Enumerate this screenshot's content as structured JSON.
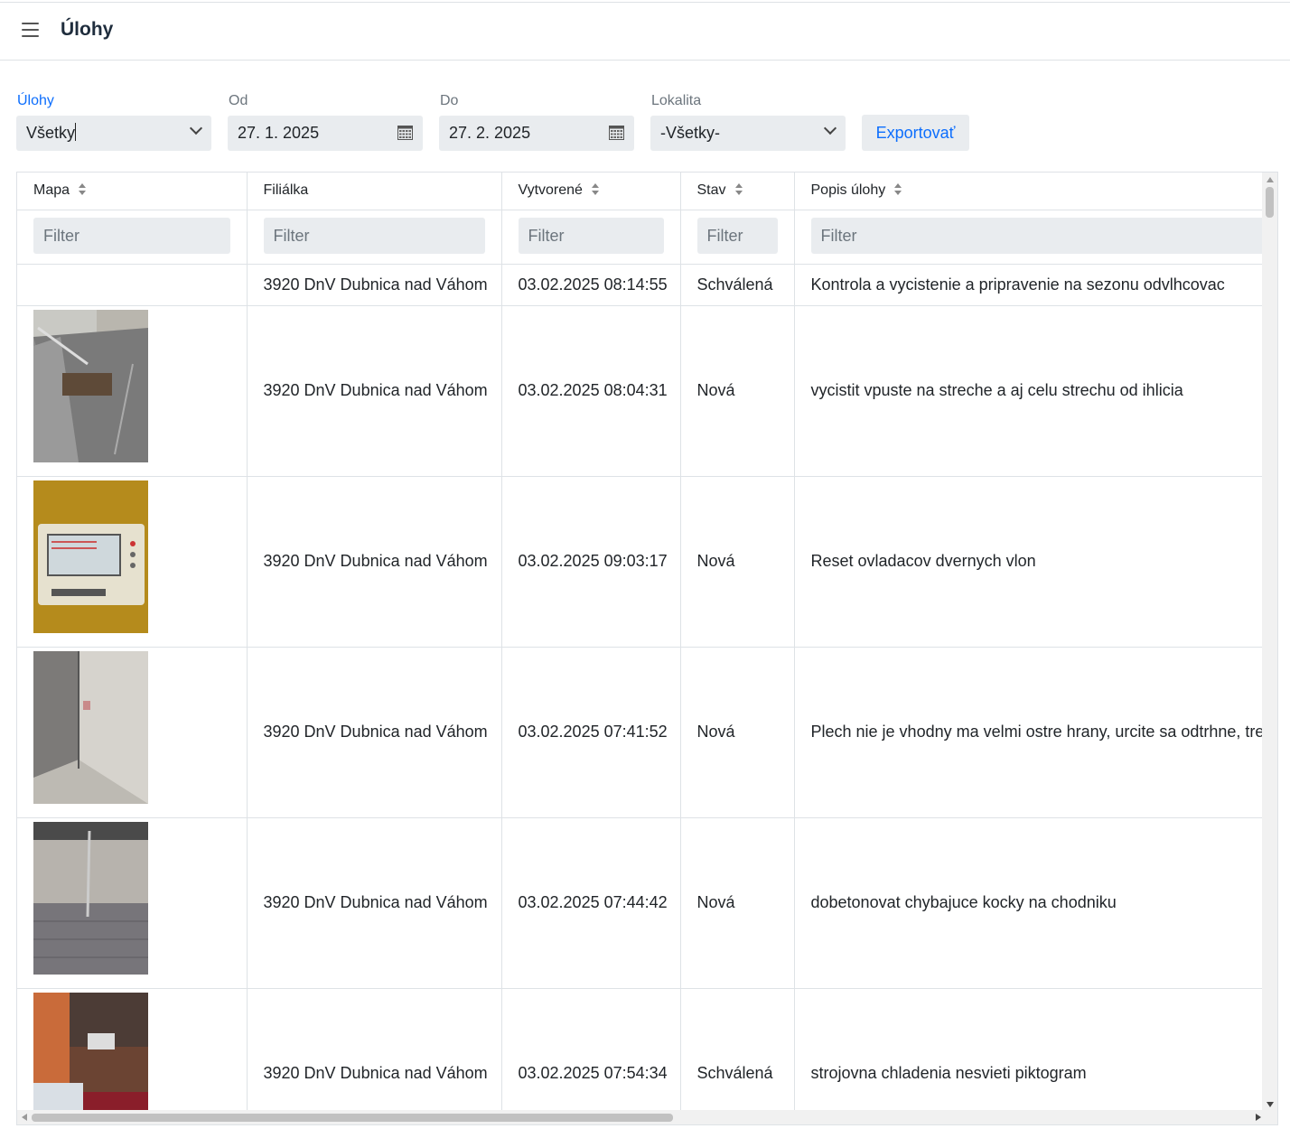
{
  "header": {
    "title": "Úlohy"
  },
  "filters": {
    "tasks": {
      "label": "Úlohy",
      "value": "Všetky"
    },
    "from": {
      "label": "Od",
      "value": "27. 1. 2025"
    },
    "to": {
      "label": "Do",
      "value": "27. 2. 2025"
    },
    "location": {
      "label": "Lokalita",
      "value": "-Všetky-"
    },
    "export_label": "Exportovať"
  },
  "table": {
    "columns": [
      "Mapa",
      "Filiálka",
      "Vytvorené",
      "Stav",
      "Popis úlohy"
    ],
    "filter_placeholder": "Filter",
    "rows": [
      {
        "branch": "3920 DnV Dubnica nad Váhom",
        "created": "03.02.2025 08:14:55",
        "status": "Schválená",
        "description": "Kontrola a vycistenie a pripravenie na sezonu odvlhcovac"
      },
      {
        "branch": "3920 DnV Dubnica nad Váhom",
        "created": "03.02.2025 08:04:31",
        "status": "Nová",
        "description": "vycistit vpuste na streche a aj celu strechu od ihlicia"
      },
      {
        "branch": "3920 DnV Dubnica nad Váhom",
        "created": "03.02.2025 09:03:17",
        "status": "Nová",
        "description": "Reset ovladacov dvernych vlon"
      },
      {
        "branch": "3920 DnV Dubnica nad Váhom",
        "created": "03.02.2025 07:41:52",
        "status": "Nová",
        "description": "Plech nie je vhodny ma velmi ostre hrany, urcite sa odtrhne, treba"
      },
      {
        "branch": "3920 DnV Dubnica nad Váhom",
        "created": "03.02.2025 07:44:42",
        "status": "Nová",
        "description": "dobetonovat chybajuce kocky na chodniku"
      },
      {
        "branch": "3920 DnV Dubnica nad Váhom",
        "created": "03.02.2025 07:54:34",
        "status": "Schválená",
        "description": "strojovna chladenia nesvieti piktogram"
      }
    ]
  },
  "colors": {
    "accent": "#0d6efd",
    "field_bg": "#e9ecef",
    "border": "#dee2e6"
  }
}
